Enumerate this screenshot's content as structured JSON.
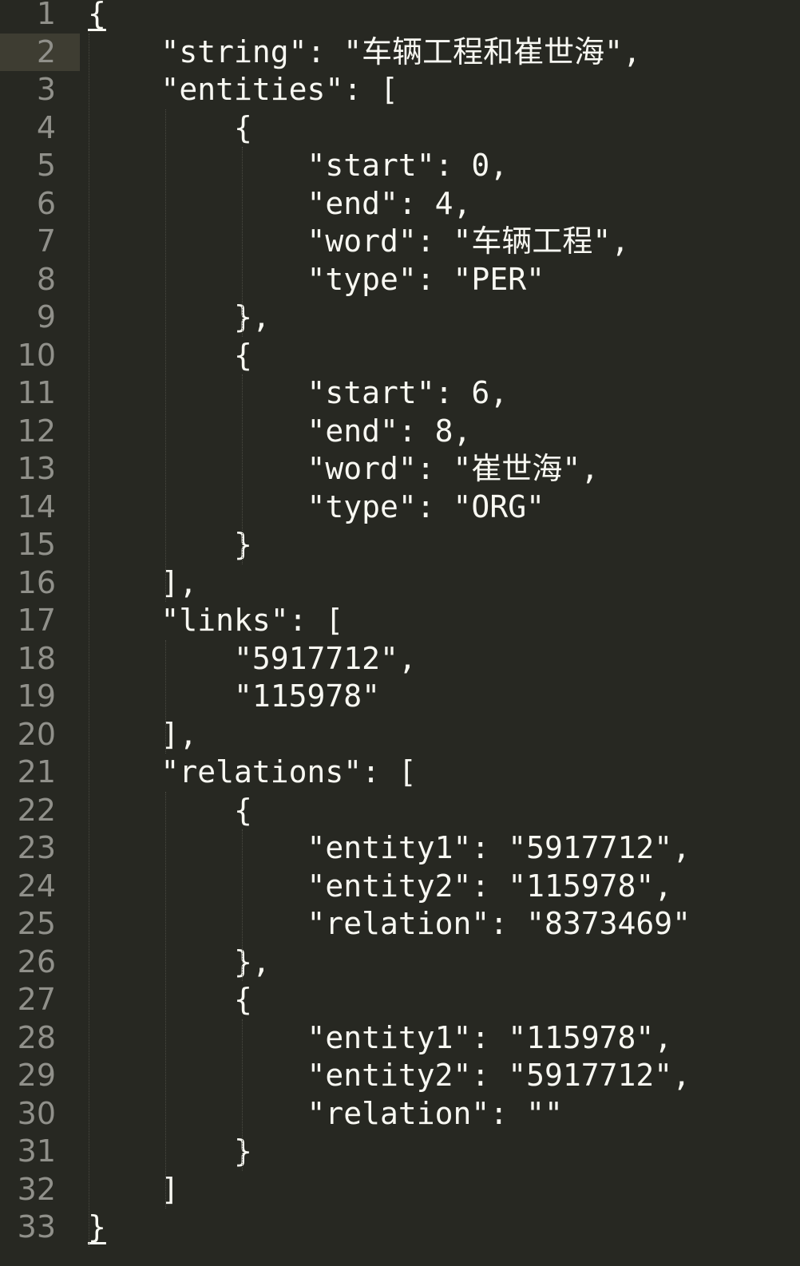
{
  "editor": {
    "active_line": 2,
    "lines": [
      {
        "n": "1",
        "text": "{"
      },
      {
        "n": "2",
        "text": "    \"string\": \"车辆工程和崔世海\","
      },
      {
        "n": "3",
        "text": "    \"entities\": ["
      },
      {
        "n": "4",
        "text": "        {"
      },
      {
        "n": "5",
        "text": "            \"start\": 0,"
      },
      {
        "n": "6",
        "text": "            \"end\": 4,"
      },
      {
        "n": "7",
        "text": "            \"word\": \"车辆工程\","
      },
      {
        "n": "8",
        "text": "            \"type\": \"PER\""
      },
      {
        "n": "9",
        "text": "        },"
      },
      {
        "n": "10",
        "text": "        {"
      },
      {
        "n": "11",
        "text": "            \"start\": 6,"
      },
      {
        "n": "12",
        "text": "            \"end\": 8,"
      },
      {
        "n": "13",
        "text": "            \"word\": \"崔世海\","
      },
      {
        "n": "14",
        "text": "            \"type\": \"ORG\""
      },
      {
        "n": "15",
        "text": "        }"
      },
      {
        "n": "16",
        "text": "    ],"
      },
      {
        "n": "17",
        "text": "    \"links\": ["
      },
      {
        "n": "18",
        "text": "        \"5917712\","
      },
      {
        "n": "19",
        "text": "        \"115978\""
      },
      {
        "n": "20",
        "text": "    ],"
      },
      {
        "n": "21",
        "text": "    \"relations\": ["
      },
      {
        "n": "22",
        "text": "        {"
      },
      {
        "n": "23",
        "text": "            \"entity1\": \"5917712\","
      },
      {
        "n": "24",
        "text": "            \"entity2\": \"115978\","
      },
      {
        "n": "25",
        "text": "            \"relation\": \"8373469\""
      },
      {
        "n": "26",
        "text": "        },"
      },
      {
        "n": "27",
        "text": "        {"
      },
      {
        "n": "28",
        "text": "            \"entity1\": \"115978\","
      },
      {
        "n": "29",
        "text": "            \"entity2\": \"5917712\","
      },
      {
        "n": "30",
        "text": "            \"relation\": \"\""
      },
      {
        "n": "31",
        "text": "        }"
      },
      {
        "n": "32",
        "text": "    ]"
      },
      {
        "n": "33",
        "text": "}"
      }
    ]
  },
  "colors": {
    "background": "#272822",
    "text": "#f8f8f2",
    "line_number": "#90908a",
    "active_line": "#3e3d32",
    "indent_guide": "#4a4a42"
  }
}
